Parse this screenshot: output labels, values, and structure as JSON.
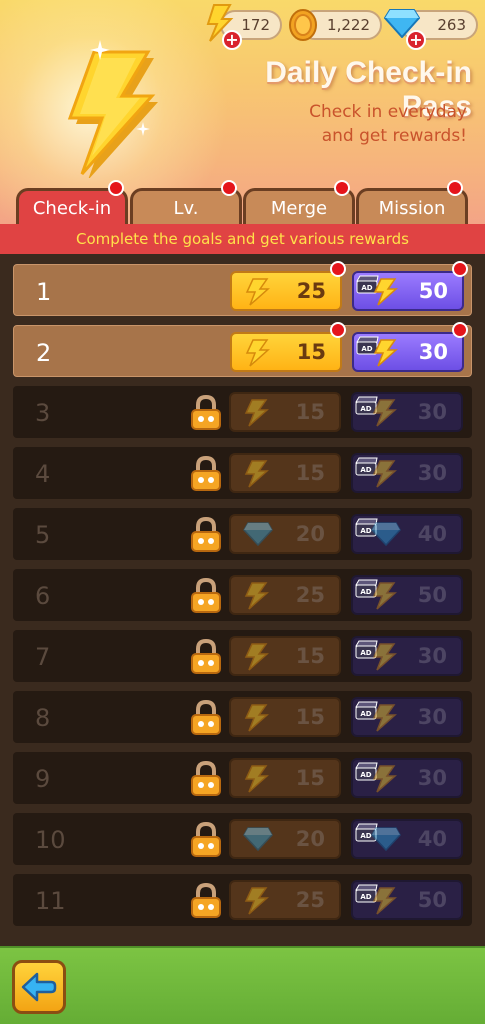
{
  "resources": {
    "energy": "172",
    "coins": "1,222",
    "gems": "263"
  },
  "header": {
    "title": "Daily Check-in Pass",
    "subtitle_line1": "Check in everyday",
    "subtitle_line2": "and get rewards!"
  },
  "tabs": [
    {
      "label": "Check-in",
      "active": true
    },
    {
      "label": "Lv.",
      "active": false
    },
    {
      "label": "Merge",
      "active": false
    },
    {
      "label": "Mission",
      "active": false
    }
  ],
  "banner": "Complete the goals and get various rewards",
  "rows": [
    {
      "day": "1",
      "free_icon": "bolt-icon",
      "free": "25",
      "ad_icon": "bolt-icon",
      "ad": "50",
      "unlocked": true
    },
    {
      "day": "2",
      "free_icon": "bolt-icon",
      "free": "15",
      "ad_icon": "bolt-icon",
      "ad": "30",
      "unlocked": true
    },
    {
      "day": "3",
      "free_icon": "bolt-icon",
      "free": "15",
      "ad_icon": "bolt-icon",
      "ad": "30",
      "unlocked": false
    },
    {
      "day": "4",
      "free_icon": "bolt-icon",
      "free": "15",
      "ad_icon": "bolt-icon",
      "ad": "30",
      "unlocked": false
    },
    {
      "day": "5",
      "free_icon": "gem-icon",
      "free": "20",
      "ad_icon": "gem-icon",
      "ad": "40",
      "unlocked": false
    },
    {
      "day": "6",
      "free_icon": "bolt-icon",
      "free": "25",
      "ad_icon": "bolt-icon",
      "ad": "50",
      "unlocked": false
    },
    {
      "day": "7",
      "free_icon": "bolt-icon",
      "free": "15",
      "ad_icon": "bolt-icon",
      "ad": "30",
      "unlocked": false
    },
    {
      "day": "8",
      "free_icon": "bolt-icon",
      "free": "15",
      "ad_icon": "bolt-icon",
      "ad": "30",
      "unlocked": false
    },
    {
      "day": "9",
      "free_icon": "bolt-icon",
      "free": "15",
      "ad_icon": "bolt-icon",
      "ad": "30",
      "unlocked": false
    },
    {
      "day": "10",
      "free_icon": "gem-icon",
      "free": "20",
      "ad_icon": "gem-icon",
      "ad": "40",
      "unlocked": false
    },
    {
      "day": "11",
      "free_icon": "bolt-icon",
      "free": "25",
      "ad_icon": "bolt-icon",
      "ad": "50",
      "unlocked": false
    }
  ],
  "colors": {
    "tab_active": "#e04343",
    "banner_text": "#ffe24a",
    "free_pill": "#ffc11f",
    "ad_pill": "#7b5cf0"
  }
}
